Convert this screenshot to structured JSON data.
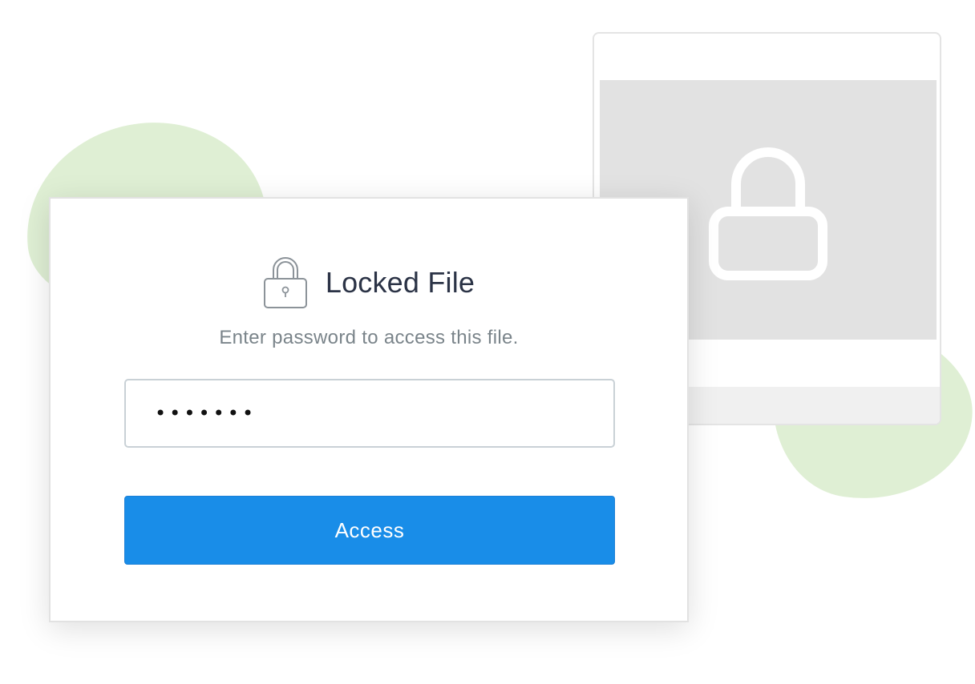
{
  "dialog": {
    "title": "Locked File",
    "subtitle": "Enter password to access this file.",
    "password_value": "•••••••",
    "button_label": "Access",
    "title_icon": "padlock-icon"
  },
  "preview": {
    "icon": "padlock-icon"
  },
  "colors": {
    "accent": "#198de8",
    "blob": "#dfefd4",
    "title_text": "#2b3346",
    "subtitle_text": "#7a848a",
    "preview_image": "#e2e2e2"
  }
}
